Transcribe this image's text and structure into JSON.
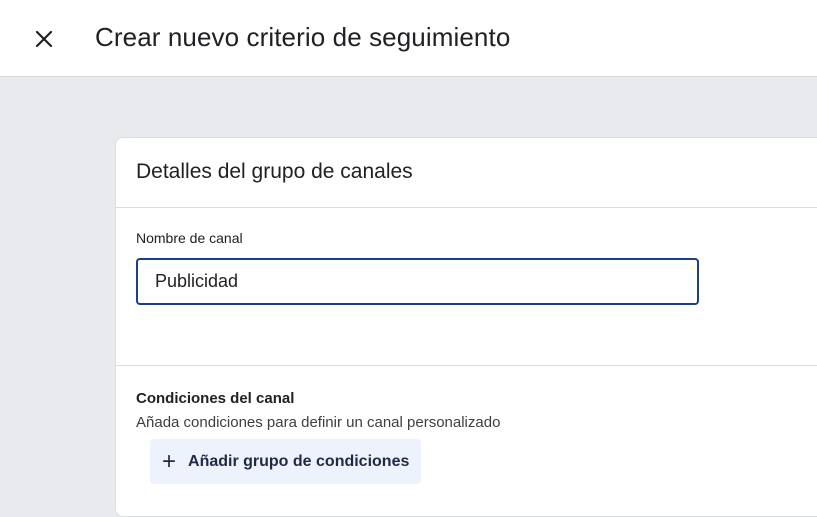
{
  "header": {
    "title": "Crear nuevo criterio de seguimiento",
    "close_icon": "close-icon"
  },
  "card": {
    "title": "Detalles del grupo de canales",
    "name_field": {
      "label": "Nombre de canal",
      "value": "Publicidad"
    },
    "conditions": {
      "title": "Condiciones del canal",
      "description": "Añada condiciones para definir un canal personalizado",
      "add_button_label": "Añadir grupo de condiciones",
      "add_button_icon": "plus-icon"
    }
  },
  "colors": {
    "background": "#e8eaed",
    "input_border": "#1a3f8b",
    "button_background": "#eef2fc"
  }
}
